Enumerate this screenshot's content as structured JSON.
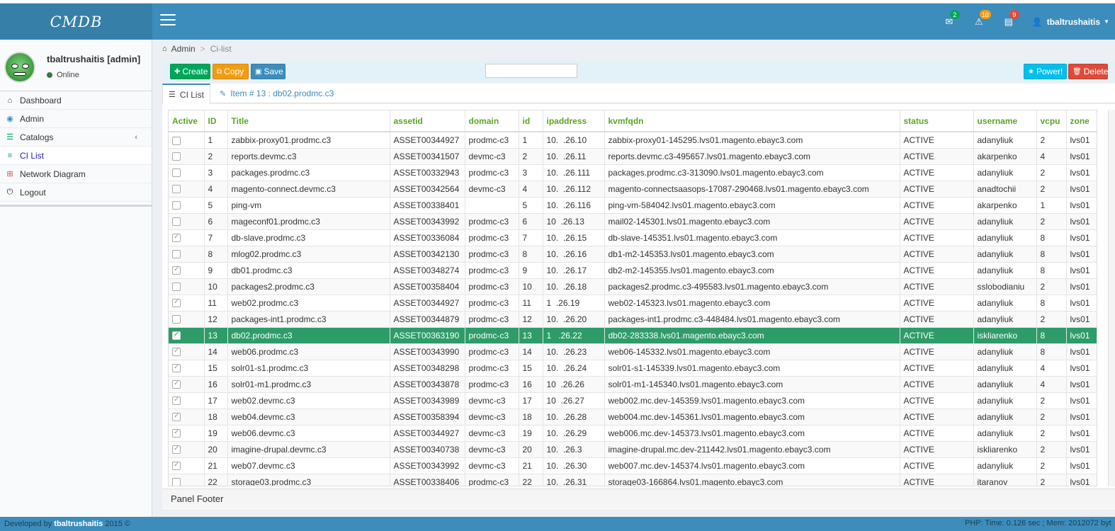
{
  "app": {
    "logo": "CMDB"
  },
  "topbar": {
    "messages_count": "2",
    "alerts_count": "10",
    "tasks_count": "9",
    "user": "tbaltrushaitis",
    "colors": {
      "messages_badge": "#00a65a",
      "alerts_badge": "#f39c12",
      "tasks_badge": "#dd4b39"
    }
  },
  "sidebar": {
    "user_name": "tbaltrushaitis [admin]",
    "status": "Online",
    "items": [
      {
        "label": "Dashboard",
        "icon": "home-icon"
      },
      {
        "label": "Admin",
        "icon": "globe-icon"
      },
      {
        "label": "Catalogs",
        "icon": "database-icon"
      },
      {
        "label": "CI List",
        "icon": "list-icon"
      },
      {
        "label": "Network Diagram",
        "icon": "sitemap-icon"
      },
      {
        "label": "Logout",
        "icon": "power-icon"
      }
    ]
  },
  "breadcrumb": {
    "root": "Admin",
    "current": "Ci-list"
  },
  "toolbar": {
    "create": "Create",
    "copy": "Copy",
    "save": "Save",
    "power": "Power!",
    "delete": "Delete",
    "search_value": ""
  },
  "tabs": {
    "list": "CI List",
    "item": "Item # 13 : db02.prodmc.c3"
  },
  "table": {
    "columns": [
      "Active",
      "ID",
      "Title",
      "assetid",
      "domain",
      "id",
      "ipaddress",
      "kvmfqdn",
      "status",
      "username",
      "vcpu",
      "zone"
    ],
    "selected_id": "13",
    "rows": [
      {
        "checked": false,
        "ID": "1",
        "title": "zabbix-proxy01.prodmc.c3",
        "assetid": "ASSET00344927",
        "domain": "prodmc-c3",
        "id": "1",
        "ip": "10.  .26.10",
        "kvmfqdn": "zabbix-proxy01-145295.lvs01.magento.ebayc3.com",
        "status": "ACTIVE",
        "username": "adanyliuk",
        "vcpu": "2",
        "zone": "lvs01"
      },
      {
        "checked": false,
        "ID": "2",
        "title": "reports.devmc.c3",
        "assetid": "ASSET00341507",
        "domain": "devmc-c3",
        "id": "2",
        "ip": "10.  .26.11",
        "kvmfqdn": "reports.devmc.c3-495657.lvs01.magento.ebayc3.com",
        "status": "ACTIVE",
        "username": "akarpenko",
        "vcpu": "4",
        "zone": "lvs01"
      },
      {
        "checked": false,
        "ID": "3",
        "title": "packages.prodmc.c3",
        "assetid": "ASSET00332943",
        "domain": "prodmc-c3",
        "id": "3",
        "ip": "10.  .26.111",
        "kvmfqdn": "packages.prodmc.c3-313090.lvs01.magento.ebayc3.com",
        "status": "ACTIVE",
        "username": "adanyliuk",
        "vcpu": "2",
        "zone": "lvs01"
      },
      {
        "checked": false,
        "ID": "4",
        "title": "magento-connect.devmc.c3",
        "assetid": "ASSET00342564",
        "domain": "devmc-c3",
        "id": "4",
        "ip": "10.  .26.112",
        "kvmfqdn": "magento-connectsaasops-17087-290468.lvs01.magento.ebayc3.com",
        "status": "ACTIVE",
        "username": "anadtochii",
        "vcpu": "2",
        "zone": "lvs01"
      },
      {
        "checked": false,
        "ID": "5",
        "title": "ping-vm",
        "assetid": "ASSET00338401",
        "domain": "",
        "id": "5",
        "ip": "10.  .26.116",
        "kvmfqdn": "ping-vm-584042.lvs01.magento.ebayc3.com",
        "status": "ACTIVE",
        "username": "akarpenko",
        "vcpu": "1",
        "zone": "lvs01"
      },
      {
        "checked": false,
        "ID": "6",
        "title": "mageconf01.prodmc.c3",
        "assetid": "ASSET00343992",
        "domain": "prodmc-c3",
        "id": "6",
        "ip": "10  .26.13",
        "kvmfqdn": "mail02-145301.lvs01.magento.ebayc3.com",
        "status": "ACTIVE",
        "username": "adanyliuk",
        "vcpu": "2",
        "zone": "lvs01"
      },
      {
        "checked": true,
        "ID": "7",
        "title": "db-slave.prodmc.c3",
        "assetid": "ASSET00336084",
        "domain": "prodmc-c3",
        "id": "7",
        "ip": "10.  .26.15",
        "kvmfqdn": "db-slave-145351.lvs01.magento.ebayc3.com",
        "status": "ACTIVE",
        "username": "adanyliuk",
        "vcpu": "8",
        "zone": "lvs01"
      },
      {
        "checked": false,
        "ID": "8",
        "title": "mlog02.prodmc.c3",
        "assetid": "ASSET00342130",
        "domain": "prodmc-c3",
        "id": "8",
        "ip": "10.  .26.16",
        "kvmfqdn": "db1-m2-145353.lvs01.magento.ebayc3.com",
        "status": "ACTIVE",
        "username": "adanyliuk",
        "vcpu": "8",
        "zone": "lvs01"
      },
      {
        "checked": true,
        "ID": "9",
        "title": "db01.prodmc.c3",
        "assetid": "ASSET00348274",
        "domain": "prodmc-c3",
        "id": "9",
        "ip": "10.  .26.17",
        "kvmfqdn": "db2-m2-145355.lvs01.magento.ebayc3.com",
        "status": "ACTIVE",
        "username": "adanyliuk",
        "vcpu": "8",
        "zone": "lvs01"
      },
      {
        "checked": false,
        "ID": "10",
        "title": "packages2.prodmc.c3",
        "assetid": "ASSET00358404",
        "domain": "prodmc-c3",
        "id": "10",
        "ip": "10.  .26.18",
        "kvmfqdn": "packages2.prodmc.c3-495583.lvs01.magento.ebayc3.com",
        "status": "ACTIVE",
        "username": "sslobodianiu",
        "vcpu": "2",
        "zone": "lvs01"
      },
      {
        "checked": true,
        "ID": "11",
        "title": "web02.prodmc.c3",
        "assetid": "ASSET00344927",
        "domain": "prodmc-c3",
        "id": "11",
        "ip": "1  .26.19",
        "kvmfqdn": "web02-145323.lvs01.magento.ebayc3.com",
        "status": "ACTIVE",
        "username": "adanyliuk",
        "vcpu": "8",
        "zone": "lvs01"
      },
      {
        "checked": false,
        "ID": "12",
        "title": "packages-int1.prodmc.c3",
        "assetid": "ASSET00344879",
        "domain": "prodmc-c3",
        "id": "12",
        "ip": "10.  .26.20",
        "kvmfqdn": "packages-int1.prodmc.c3-448484.lvs01.magento.ebayc3.com",
        "status": "ACTIVE",
        "username": "adanyliuk",
        "vcpu": "2",
        "zone": "lvs01"
      },
      {
        "checked": true,
        "ID": "13",
        "title": "db02.prodmc.c3",
        "assetid": "ASSET00363190",
        "domain": "prodmc-c3",
        "id": "13",
        "ip": "1   .26.22",
        "kvmfqdn": "db02-283338.lvs01.magento.ebayc3.com",
        "status": "ACTIVE",
        "username": "iskliarenko",
        "vcpu": "8",
        "zone": "lvs01"
      },
      {
        "checked": true,
        "ID": "14",
        "title": "web06.prodmc.c3",
        "assetid": "ASSET00343990",
        "domain": "prodmc-c3",
        "id": "14",
        "ip": "10.  .26.23",
        "kvmfqdn": "web06-145332.lvs01.magento.ebayc3.com",
        "status": "ACTIVE",
        "username": "adanyliuk",
        "vcpu": "8",
        "zone": "lvs01"
      },
      {
        "checked": true,
        "ID": "15",
        "title": "solr01-s1.prodmc.c3",
        "assetid": "ASSET00348298",
        "domain": "prodmc-c3",
        "id": "15",
        "ip": "10.  .26.24",
        "kvmfqdn": "solr01-s1-145339.lvs01.magento.ebayc3.com",
        "status": "ACTIVE",
        "username": "adanyliuk",
        "vcpu": "4",
        "zone": "lvs01"
      },
      {
        "checked": true,
        "ID": "16",
        "title": "solr01-m1.prodmc.c3",
        "assetid": "ASSET00343878",
        "domain": "prodmc-c3",
        "id": "16",
        "ip": "10  .26.26",
        "kvmfqdn": "solr01-m1-145340.lvs01.magento.ebayc3.com",
        "status": "ACTIVE",
        "username": "adanyliuk",
        "vcpu": "4",
        "zone": "lvs01"
      },
      {
        "checked": true,
        "ID": "17",
        "title": "web02.devmc.c3",
        "assetid": "ASSET00343989",
        "domain": "devmc-c3",
        "id": "17",
        "ip": "10  .26.27",
        "kvmfqdn": "web002.mc.dev-145359.lvs01.magento.ebayc3.com",
        "status": "ACTIVE",
        "username": "adanyliuk",
        "vcpu": "2",
        "zone": "lvs01"
      },
      {
        "checked": true,
        "ID": "18",
        "title": "web04.devmc.c3",
        "assetid": "ASSET00358394",
        "domain": "devmc-c3",
        "id": "18",
        "ip": "10.  .26.28",
        "kvmfqdn": "web004.mc.dev-145361.lvs01.magento.ebayc3.com",
        "status": "ACTIVE",
        "username": "adanyliuk",
        "vcpu": "2",
        "zone": "lvs01"
      },
      {
        "checked": true,
        "ID": "19",
        "title": "web06.devmc.c3",
        "assetid": "ASSET00344927",
        "domain": "devmc-c3",
        "id": "19",
        "ip": "10.  .26.29",
        "kvmfqdn": "web006.mc.dev-145373.lvs01.magento.ebayc3.com",
        "status": "ACTIVE",
        "username": "adanyliuk",
        "vcpu": "2",
        "zone": "lvs01"
      },
      {
        "checked": true,
        "ID": "20",
        "title": "imagine-drupal.devmc.c3",
        "assetid": "ASSET00340738",
        "domain": "devmc-c3",
        "id": "20",
        "ip": "10.  .26.3",
        "kvmfqdn": "imagine-drupal.mc.dev-211442.lvs01.magento.ebayc3.com",
        "status": "ACTIVE",
        "username": "iskliarenko",
        "vcpu": "2",
        "zone": "lvs01"
      },
      {
        "checked": true,
        "ID": "21",
        "title": "web07.devmc.c3",
        "assetid": "ASSET00343992",
        "domain": "devmc-c3",
        "id": "21",
        "ip": "10.  .26.30",
        "kvmfqdn": "web007.mc.dev-145374.lvs01.magento.ebayc3.com",
        "status": "ACTIVE",
        "username": "adanyliuk",
        "vcpu": "2",
        "zone": "lvs01"
      },
      {
        "checked": false,
        "ID": "22",
        "title": "storage03.prodmc.c3",
        "assetid": "ASSET00338406",
        "domain": "prodmc-c3",
        "id": "22",
        "ip": "10.  .26.31",
        "kvmfqdn": "storage03-166864.lvs01.magento.ebayc3.com",
        "status": "ACTIVE",
        "username": "itaranov",
        "vcpu": "2",
        "zone": "lvs01"
      }
    ]
  },
  "panel": {
    "footer": "Panel Footer"
  },
  "footer": {
    "developed_by": "Developed by",
    "author": "tbaltrushaitis",
    "year": "2015 ©",
    "perf": "PHP:  Time: 0.126 sec ;  Mem: 2012072 byt"
  }
}
